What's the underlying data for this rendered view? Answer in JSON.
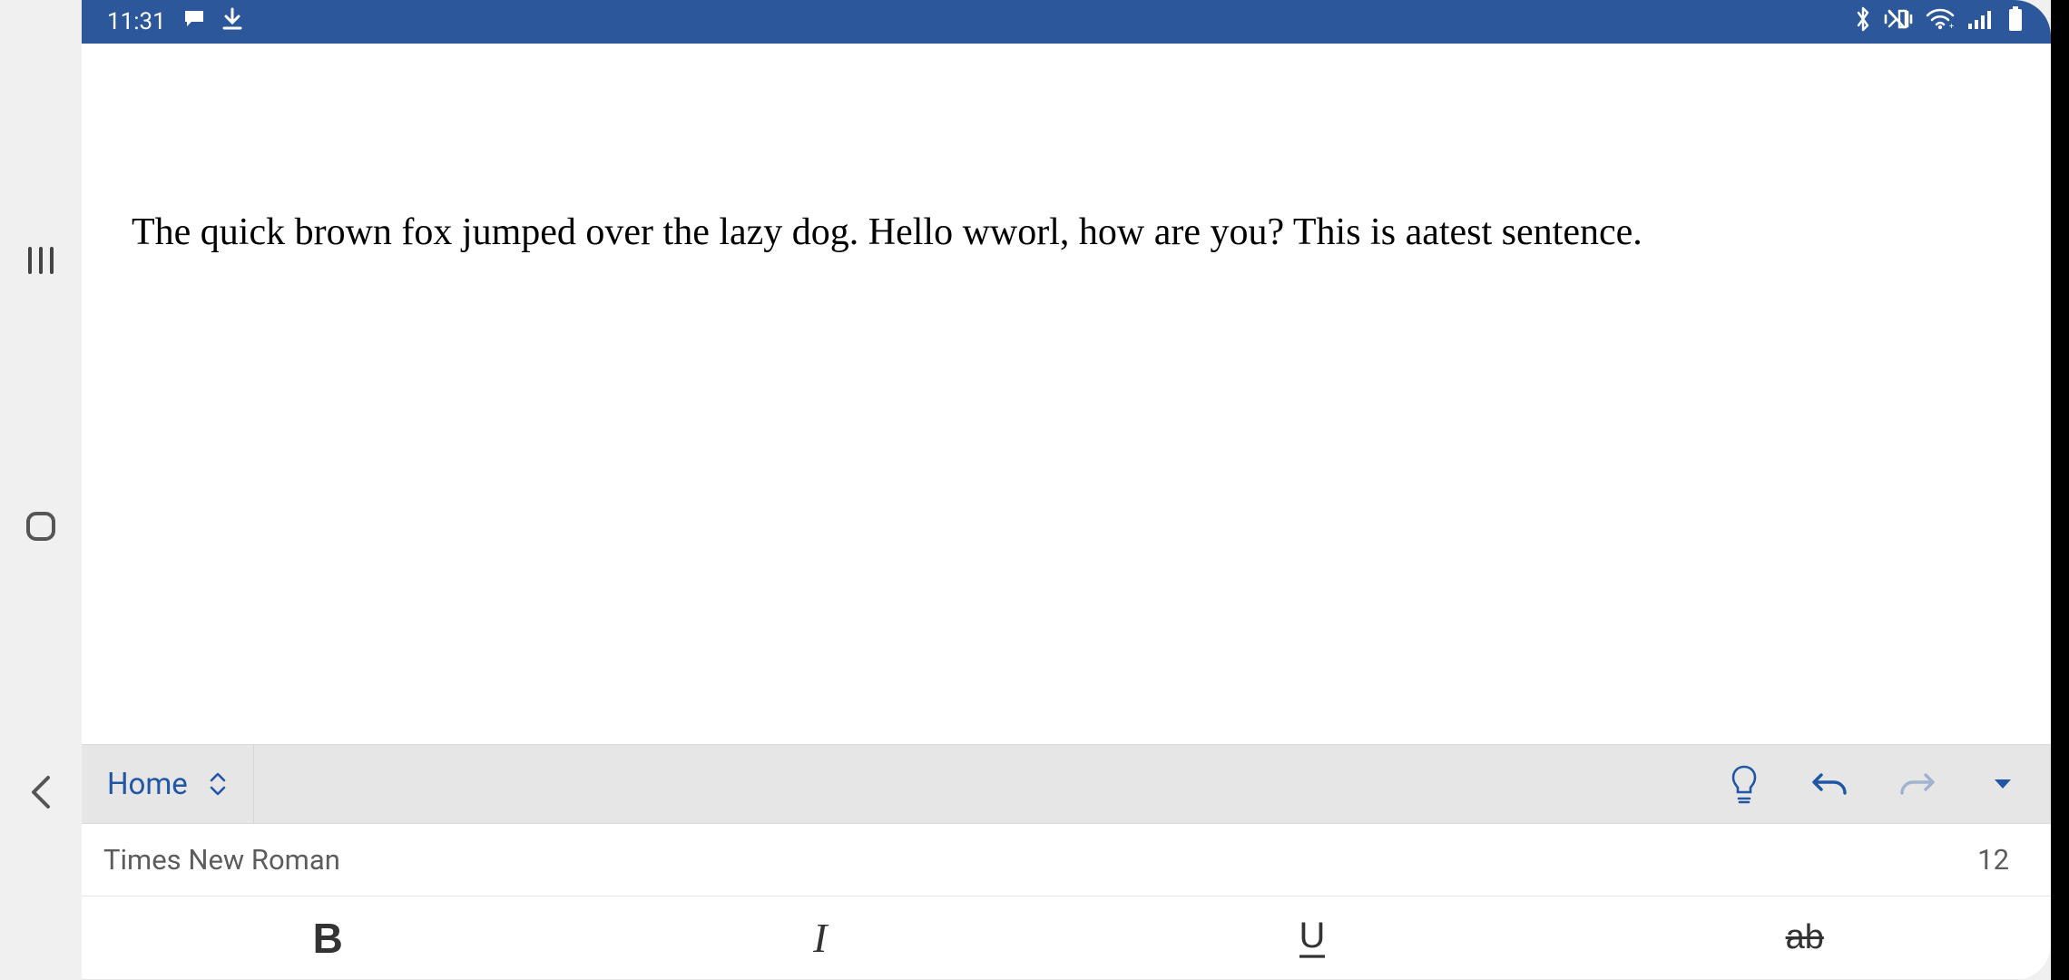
{
  "status_bar": {
    "time": "11:31",
    "icons_left": [
      "chat-icon",
      "download-icon"
    ],
    "icons_right": [
      "bluetooth-icon",
      "vibrate-icon",
      "wifi-icon",
      "signal-icon",
      "battery-icon"
    ]
  },
  "document": {
    "text": "The quick brown fox jumped over the lazy dog. Hello wworl, how are you? This is aatest sentence."
  },
  "ribbon": {
    "tab_label": "Home",
    "actions": [
      "lightbulb-icon",
      "undo-icon",
      "redo-icon",
      "dropdown-icon"
    ]
  },
  "font": {
    "name": "Times New Roman",
    "size": "12"
  },
  "format": {
    "bold": "B",
    "italic": "I",
    "underline": "U",
    "strike": "ab"
  },
  "nav_rail": [
    "recent-apps-icon",
    "home-icon",
    "back-icon"
  ],
  "colors": {
    "brand_blue": "#2c579b",
    "accent_blue": "#2156a5"
  }
}
